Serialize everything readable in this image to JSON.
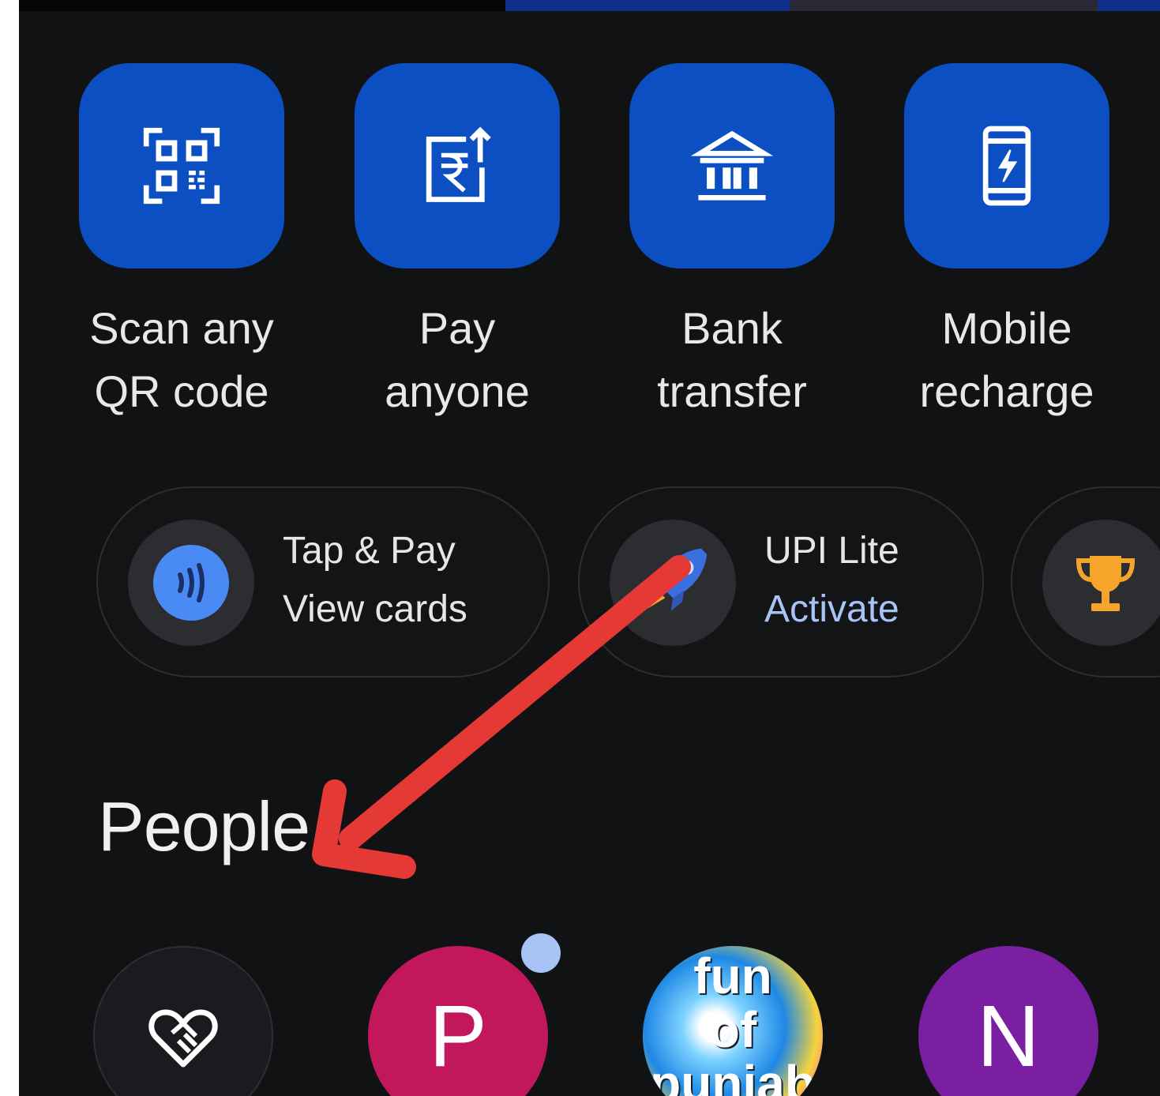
{
  "quick_actions": [
    {
      "id": "scan",
      "label": "Scan any\nQR code",
      "icon": "qr-scan-icon"
    },
    {
      "id": "pay",
      "label": "Pay\nanyone",
      "icon": "rupee-send-icon"
    },
    {
      "id": "bank",
      "label": "Bank\ntransfer",
      "icon": "bank-icon"
    },
    {
      "id": "mobile",
      "label": "Mobile\nrecharge",
      "icon": "mobile-charge-icon"
    }
  ],
  "chips": [
    {
      "id": "tap-pay",
      "title": "Tap & Pay",
      "action": "View cards",
      "icon": "contactless-icon"
    },
    {
      "id": "upi-lite",
      "title": "UPI Lite",
      "action": "Activate",
      "icon": "rocket-icon"
    },
    {
      "id": "rewards",
      "icon": "trophy-icon"
    }
  ],
  "people": {
    "title": "People",
    "avatars": [
      {
        "id": "donate",
        "icon": "heart-handshake-icon"
      },
      {
        "id": "p",
        "letter": "P",
        "color": "#c2185b",
        "unread": true
      },
      {
        "id": "fun",
        "text": "fun\nof\npunjab"
      },
      {
        "id": "n",
        "letter": "N",
        "color": "#7b1fa2"
      }
    ]
  },
  "colors": {
    "background": "#111214",
    "tile": "#0b4fc2",
    "accent_link": "#a8c4f7",
    "annotation_arrow": "#e53935"
  }
}
